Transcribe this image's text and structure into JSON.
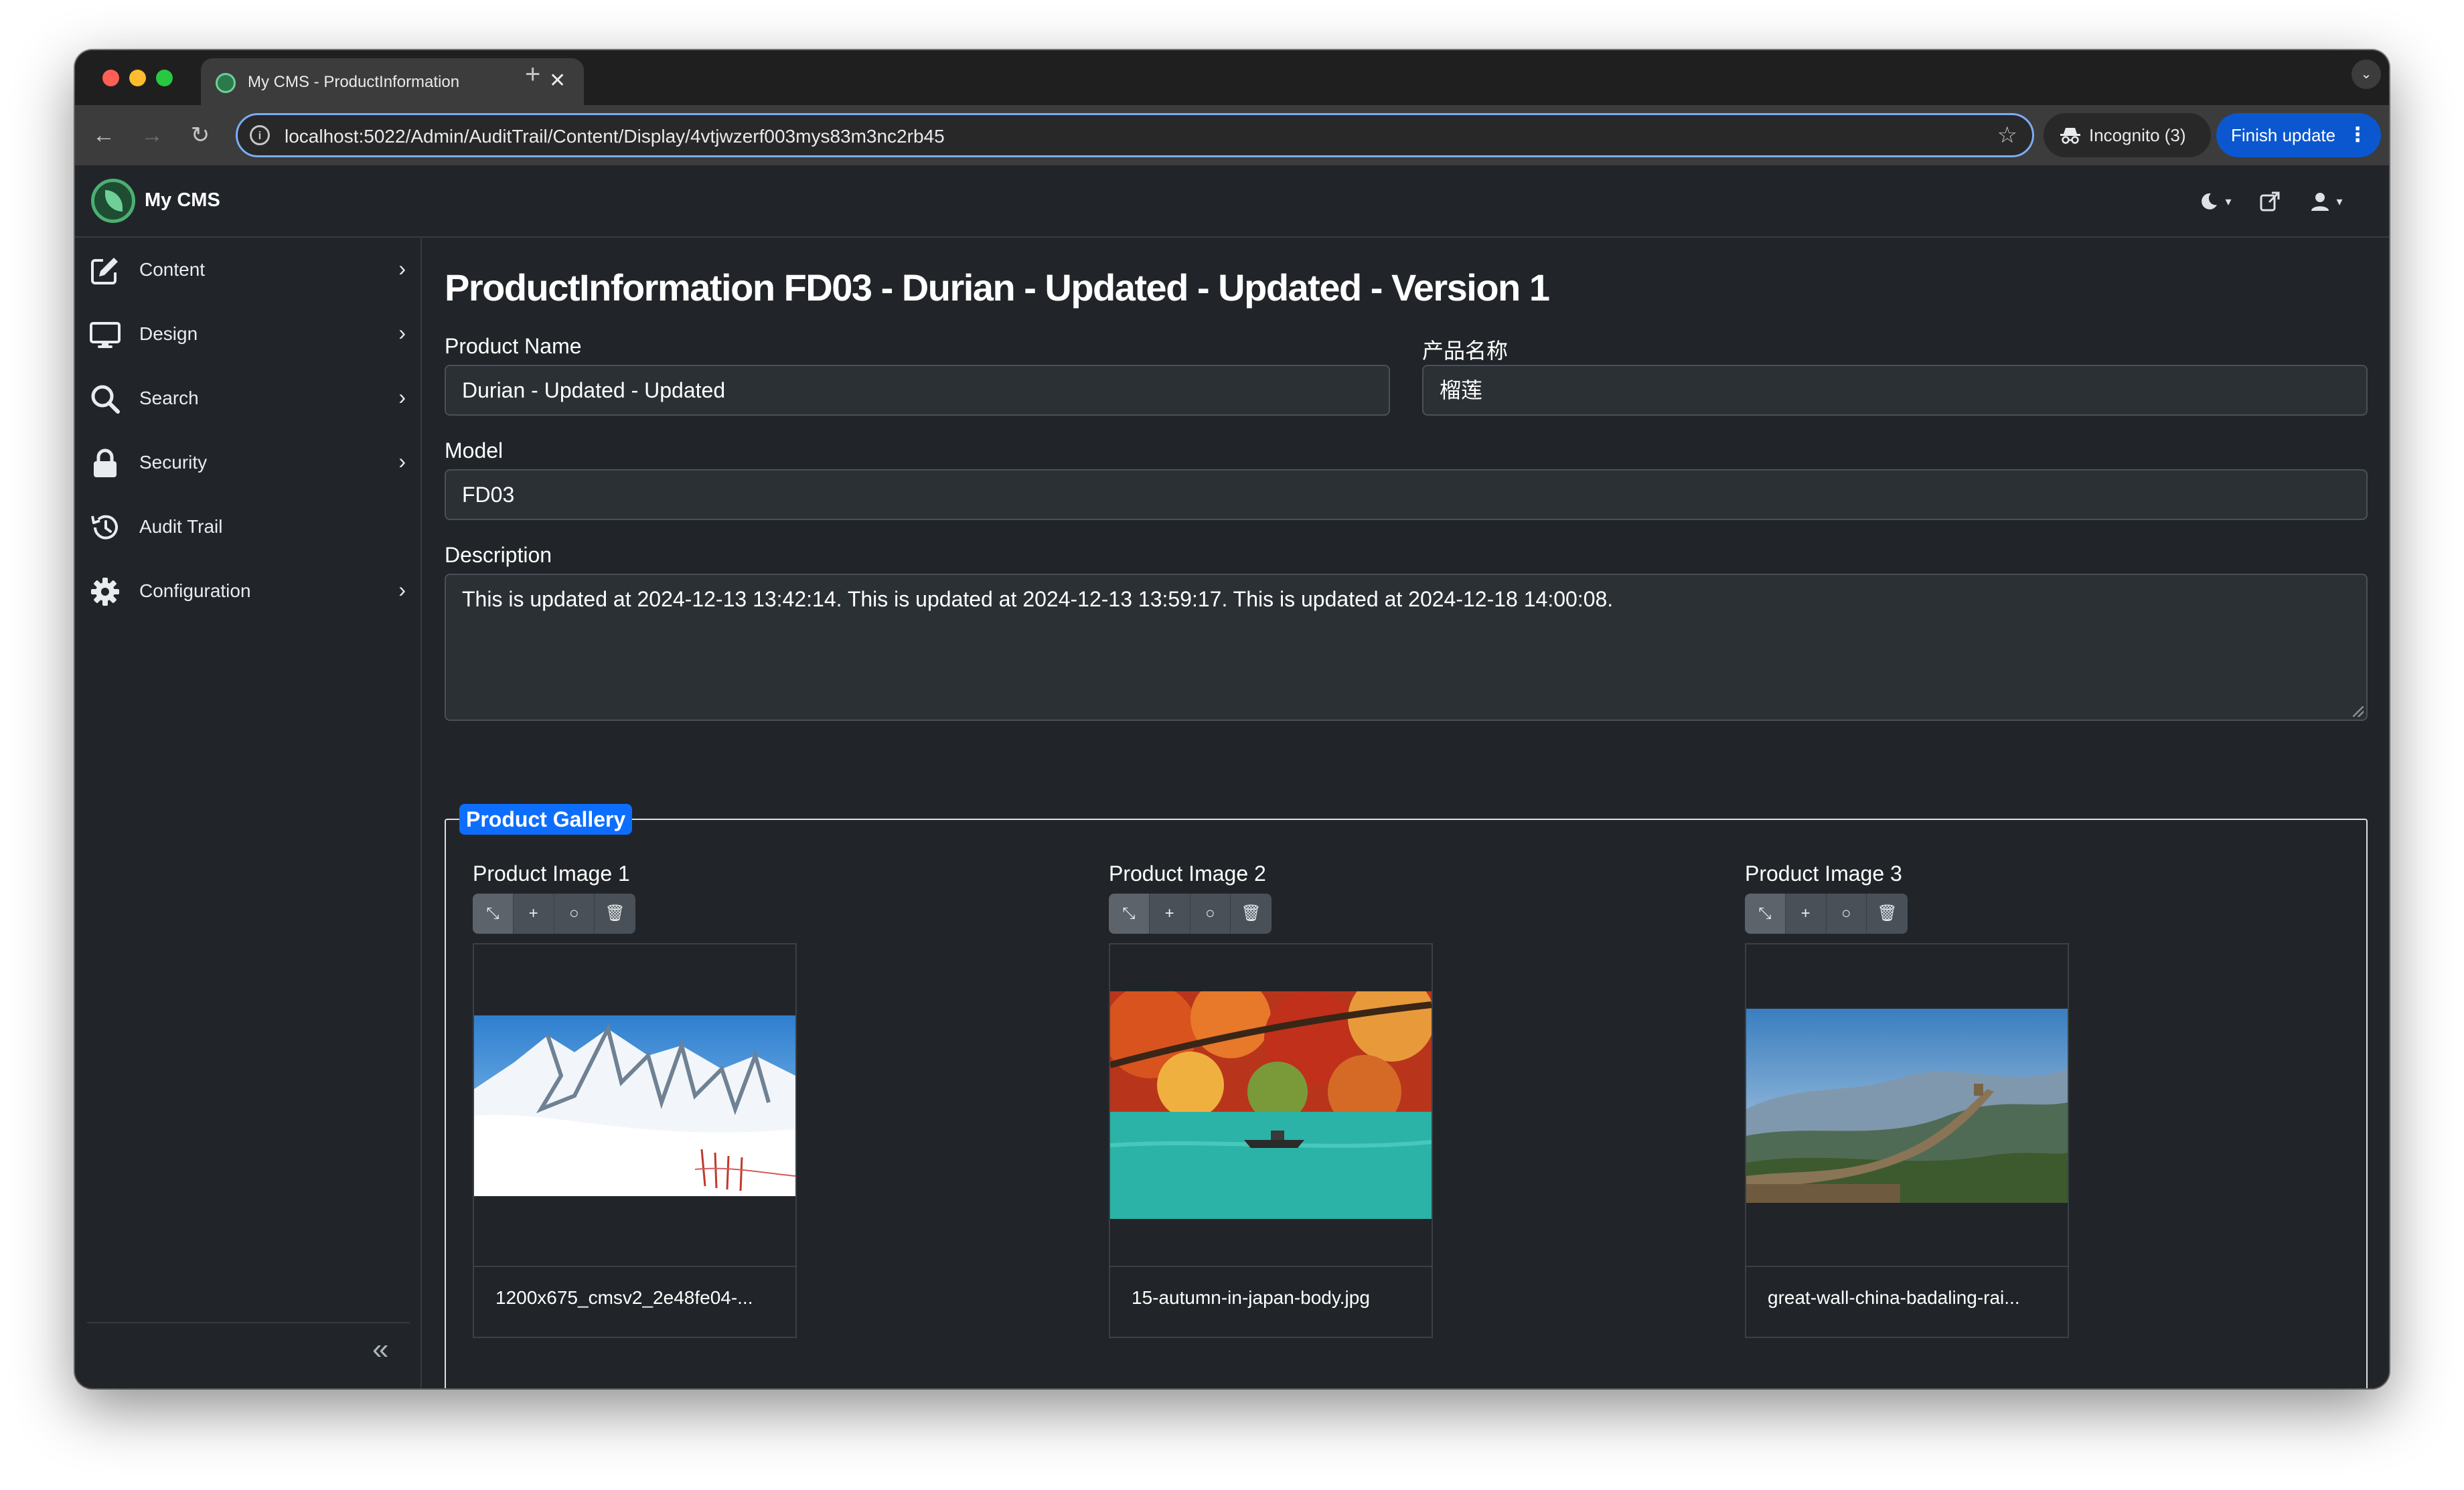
{
  "browser": {
    "tab_title": "My CMS - ProductInformation",
    "url": "localhost:5022/Admin/AuditTrail/Content/Display/4vtjwzerf003mys83m3nc2rb45",
    "incognito_label": "Incognito (3)",
    "finish_update_label": "Finish update"
  },
  "app": {
    "brand": "My CMS"
  },
  "sidebar": {
    "items": [
      {
        "label": "Content",
        "icon": "edit-icon",
        "has_children": true
      },
      {
        "label": "Design",
        "icon": "monitor-icon",
        "has_children": true
      },
      {
        "label": "Search",
        "icon": "search-icon",
        "has_children": true
      },
      {
        "label": "Security",
        "icon": "lock-icon",
        "has_children": true
      },
      {
        "label": "Audit Trail",
        "icon": "history-icon",
        "has_children": false
      },
      {
        "label": "Configuration",
        "icon": "gear-icon",
        "has_children": true
      }
    ]
  },
  "page": {
    "title": "ProductInformation FD03 - Durian - Updated - Updated - Version 1",
    "fields": {
      "product_name": {
        "label": "Product Name",
        "value": "Durian - Updated - Updated"
      },
      "product_name_cn": {
        "label": "产品名称",
        "value": "榴莲"
      },
      "model": {
        "label": "Model",
        "value": "FD03"
      },
      "description": {
        "label": "Description",
        "value": "This is updated at 2024-12-13 13:42:14. This is updated at 2024-12-13 13:59:17. This is updated at 2024-12-18 14:00:08."
      }
    },
    "gallery": {
      "legend": "Product Gallery",
      "images": [
        {
          "title": "Product Image 1",
          "caption": "1200x675_cmsv2_2e48fe04-..."
        },
        {
          "title": "Product Image 2",
          "caption": "15-autumn-in-japan-body.jpg"
        },
        {
          "title": "Product Image 3",
          "caption": "great-wall-china-badaling-rai..."
        }
      ]
    }
  },
  "colors": {
    "accent": "#0d6efd",
    "background": "#212529",
    "input_bg": "#2b3035"
  }
}
